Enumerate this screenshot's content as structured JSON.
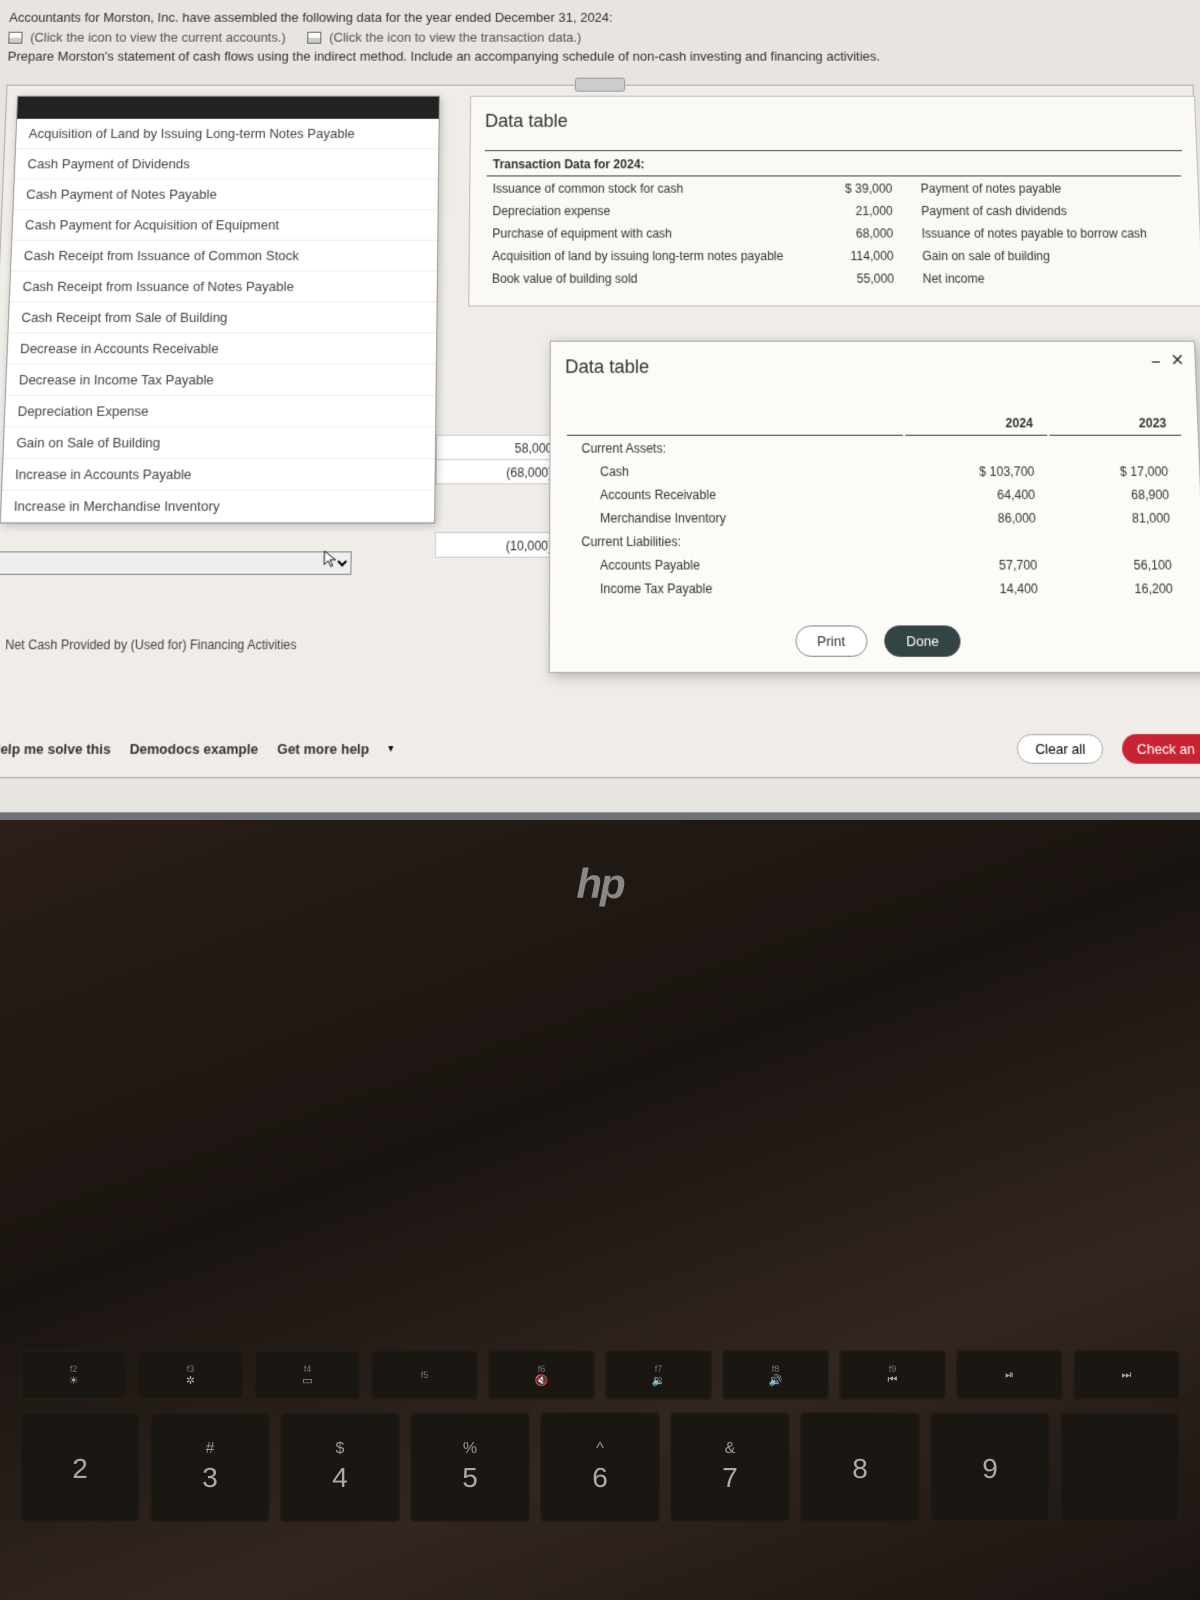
{
  "header": {
    "line1": "Accountants for Morston, Inc. have assembled the following data for the year ended December 31, 2024:",
    "link1": "(Click the icon to view the current accounts.)",
    "link2": "(Click the icon to view the transaction data.)",
    "line2": "Prepare Morston's statement of cash flows using the indirect method. Include an accompanying schedule of non-cash investing and financing activities."
  },
  "dropdown": {
    "items": [
      "Acquisition of Land by Issuing Long-term Notes Payable",
      "Cash Payment of Dividends",
      "Cash Payment of Notes Payable",
      "Cash Payment for Acquisition of Equipment",
      "Cash Receipt from Issuance of Common Stock",
      "Cash Receipt from Issuance of Notes Payable",
      "Cash Receipt from Sale of Building",
      "Decrease in Accounts Receivable",
      "Decrease in Income Tax Payable",
      "Depreciation Expense",
      "Gain on Sale of Building",
      "Increase in Accounts Payable",
      "Increase in Merchandise Inventory"
    ]
  },
  "worksheet": {
    "v1": "58,000",
    "v2": "(68,000)",
    "v3": "(10,000)",
    "section_label": "Net Cash Provided by (Used for) Financing Activities"
  },
  "transactions": {
    "title": "Data table",
    "subtitle": "Transaction Data for 2024:",
    "rows_left": [
      {
        "label": "Issuance of common stock for cash",
        "amt": "$ 39,000"
      },
      {
        "label": "Depreciation expense",
        "amt": "21,000"
      },
      {
        "label": "Purchase of equipment with cash",
        "amt": "68,000"
      },
      {
        "label": "Acquisition of land by issuing long-term notes payable",
        "amt": "114,000"
      },
      {
        "label": "Book value of building sold",
        "amt": "55,000"
      }
    ],
    "rows_right": [
      "Payment of notes payable",
      "Payment of cash dividends",
      "Issuance of notes payable to borrow cash",
      "Gain on sale of building",
      "Net income"
    ]
  },
  "balance": {
    "title": "Data table",
    "year1": "2024",
    "year2": "2023",
    "sections": {
      "ca": "Current Assets:",
      "cl": "Current Liabilities:"
    },
    "rows": [
      {
        "label": "Cash",
        "y1": "$ 103,700",
        "y2": "$ 17,000"
      },
      {
        "label": "Accounts Receivable",
        "y1": "64,400",
        "y2": "68,900"
      },
      {
        "label": "Merchandise Inventory",
        "y1": "86,000",
        "y2": "81,000"
      }
    ],
    "rows2": [
      {
        "label": "Accounts Payable",
        "y1": "57,700",
        "y2": "56,100"
      },
      {
        "label": "Income Tax Payable",
        "y1": "14,400",
        "y2": "16,200"
      }
    ],
    "print": "Print",
    "done": "Done"
  },
  "bottom": {
    "help": "Help me solve this",
    "demo": "Demodocs example",
    "more": "Get more help",
    "clear": "Clear all",
    "check": "Check an"
  },
  "hp": "hp",
  "fkeys": [
    {
      "top": "f2",
      "sym": "☀"
    },
    {
      "top": "f3",
      "sym": "✲"
    },
    {
      "top": "f4",
      "sym": "▭"
    },
    {
      "top": "f5",
      "sym": ""
    },
    {
      "top": "f6",
      "sym": "🔇"
    },
    {
      "top": "f7",
      "sym": "🔉"
    },
    {
      "top": "f8",
      "sym": "🔊"
    },
    {
      "top": "f9",
      "sym": "⏮"
    },
    {
      "top": "",
      "sym": "⏯"
    },
    {
      "top": "",
      "sym": "⏭"
    }
  ],
  "nkeys": [
    {
      "sym": "",
      "num": "2"
    },
    {
      "sym": "#",
      "num": "3"
    },
    {
      "sym": "$",
      "num": "4"
    },
    {
      "sym": "%",
      "num": "5"
    },
    {
      "sym": "^",
      "num": "6"
    },
    {
      "sym": "&",
      "num": "7"
    },
    {
      "sym": "",
      "num": "8"
    },
    {
      "sym": "",
      "num": "9"
    },
    {
      "sym": "",
      "num": ""
    }
  ]
}
